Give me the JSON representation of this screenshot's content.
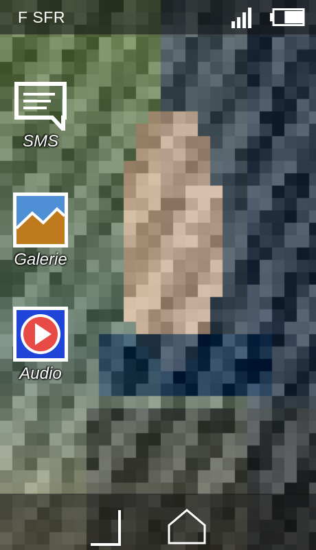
{
  "status_bar": {
    "carrier": "F SFR",
    "signal_icon": "signal-bars-icon",
    "battery_icon": "battery-icon",
    "battery_level": 0.62
  },
  "apps": [
    {
      "label": "SMS",
      "icon": "message-icon"
    },
    {
      "label": "Galerie",
      "icon": "gallery-icon"
    },
    {
      "label": "Audio",
      "icon": "play-icon"
    }
  ],
  "nav_bar": {
    "back_icon": "back-arrow-icon",
    "home_icon": "home-icon"
  },
  "colors": {
    "gallery_sky": "#4f8fd6",
    "gallery_hill": "#c07a1e",
    "audio_bg": "#1f44d8",
    "audio_circle": "#e84a45"
  }
}
